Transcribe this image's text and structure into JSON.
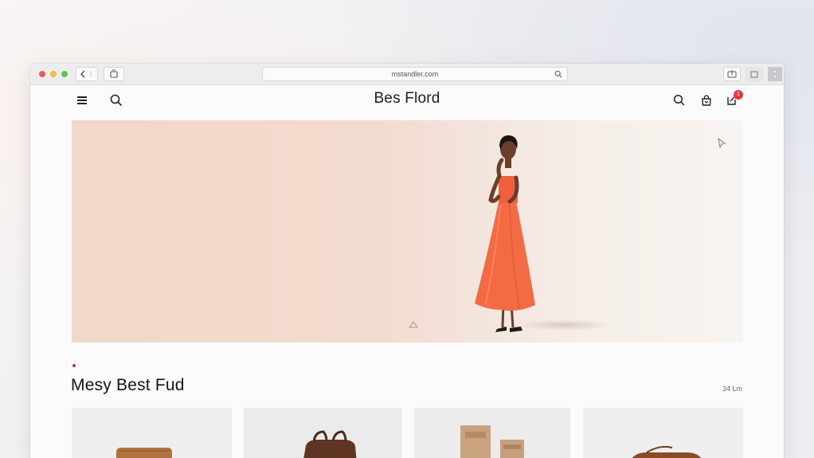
{
  "browser": {
    "url": "mstandler.com"
  },
  "site": {
    "brand": "Bes Flord",
    "cart_count": "1"
  },
  "section": {
    "title": "Mesy Best Fud",
    "link": "34 Lm"
  },
  "icons": {
    "menu": "hamburger-menu-icon",
    "search": "search-icon",
    "bag": "shopping-bag-icon",
    "cart": "cart-icon"
  },
  "colors": {
    "hero_background": "#f2d8ca",
    "dress": "#f26b45",
    "badge": "#e5353f",
    "accent_link": "#5b6b8a"
  }
}
